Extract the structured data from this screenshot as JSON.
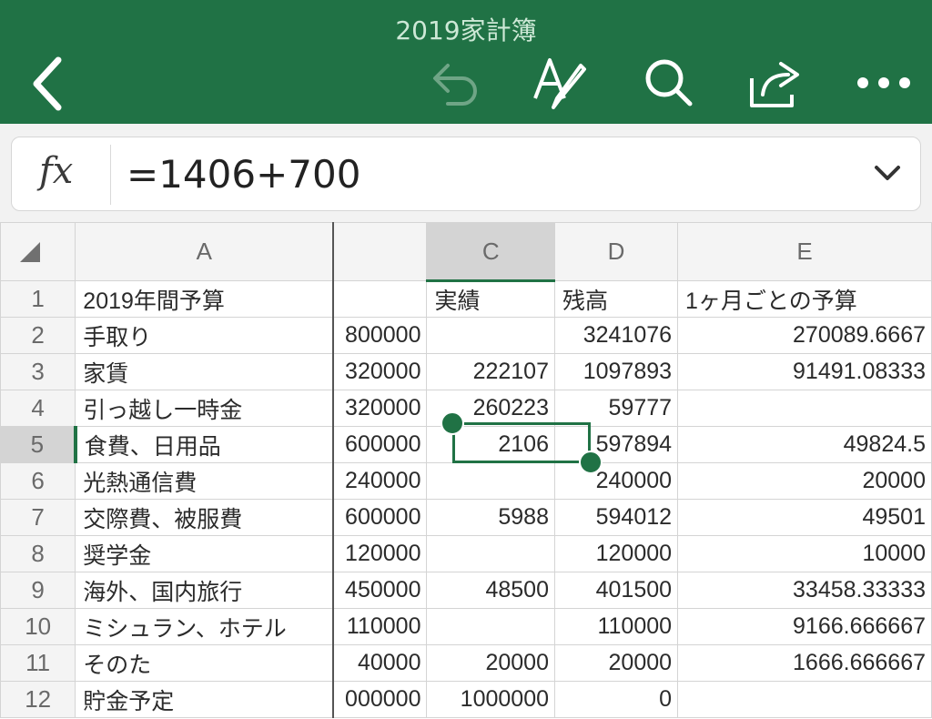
{
  "app": {
    "document_title": "2019家計簿",
    "accent_color": "#207245",
    "toolbar": {
      "back_icon": "chevron-left-icon",
      "undo_icon": "undo-icon",
      "edit_icon": "text-edit-pen-icon",
      "search_icon": "search-icon",
      "share_icon": "share-icon",
      "more_icon": "more-ellipsis-icon"
    }
  },
  "formula_bar": {
    "fx_label": "fx",
    "value": "=1406+700",
    "expand_icon": "chevron-down-icon"
  },
  "sheet": {
    "columns": [
      "A",
      "",
      "C",
      "D",
      "E"
    ],
    "selected_column": "C",
    "selected_row": "5",
    "rows": [
      {
        "num": "1",
        "a": "2019年間予算",
        "b": "",
        "c": "実績",
        "d": "残高",
        "e": "1ヶ月ごとの予算"
      },
      {
        "num": "2",
        "a": "手取り",
        "b": "800000",
        "c": "",
        "d": "3241076",
        "e": "270089.6667"
      },
      {
        "num": "3",
        "a": "家賃",
        "b": "320000",
        "c": "222107",
        "d": "1097893",
        "e": "91491.08333"
      },
      {
        "num": "4",
        "a": "引っ越し一時金",
        "b": "320000",
        "c": "260223",
        "d": "59777",
        "e": ""
      },
      {
        "num": "5",
        "a": "食費、日用品",
        "b": "600000",
        "c": "2106",
        "d": "597894",
        "e": "49824.5"
      },
      {
        "num": "6",
        "a": "光熱通信費",
        "b": "240000",
        "c": "",
        "d": "240000",
        "e": "20000"
      },
      {
        "num": "7",
        "a": "交際費、被服費",
        "b": "600000",
        "c": "5988",
        "d": "594012",
        "e": "49501"
      },
      {
        "num": "8",
        "a": "奨学金",
        "b": "120000",
        "c": "",
        "d": "120000",
        "e": "10000"
      },
      {
        "num": "9",
        "a": "海外、国内旅行",
        "b": "450000",
        "c": "48500",
        "d": "401500",
        "e": "33458.33333"
      },
      {
        "num": "10",
        "a": "ミシュラン、ホテル",
        "b": "110000",
        "c": "",
        "d": "110000",
        "e": "9166.666667"
      },
      {
        "num": "11",
        "a": "そのた",
        "b": "40000",
        "c": "20000",
        "d": "20000",
        "e": "1666.666667"
      },
      {
        "num": "12",
        "a": "貯金予定",
        "b": "000000",
        "c": "1000000",
        "d": "0",
        "e": ""
      }
    ]
  }
}
